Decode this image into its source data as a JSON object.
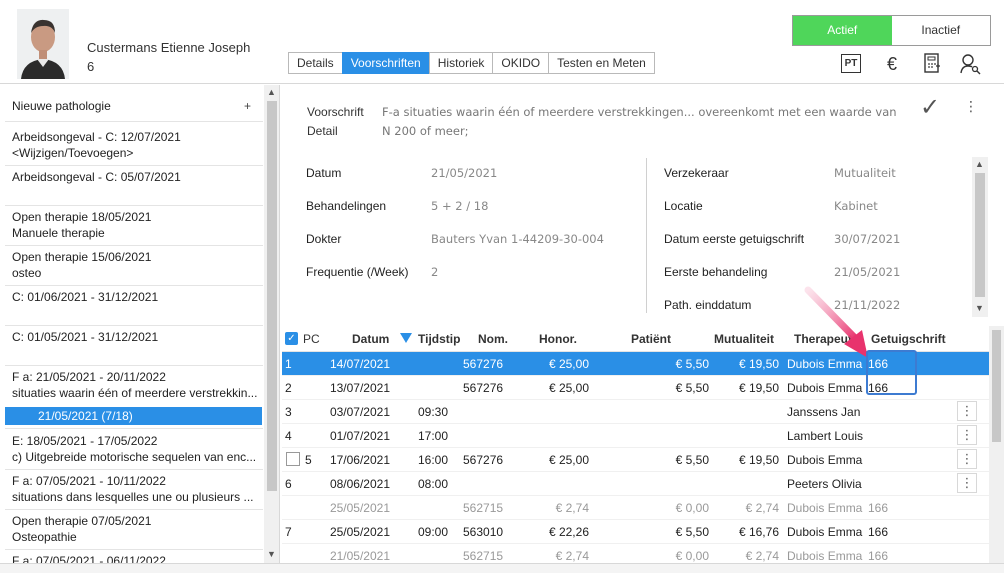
{
  "header": {
    "patient_name": "Custermans Etienne Joseph",
    "patient_number": "6",
    "tabs": [
      {
        "label": "Details"
      },
      {
        "label": "Voorschriften"
      },
      {
        "label": "Historiek"
      },
      {
        "label": "OKIDO"
      },
      {
        "label": "Testen en Meten"
      }
    ],
    "active_tab": "Voorschriften",
    "status_toggle": {
      "on": "Actief",
      "off": "Inactief"
    },
    "icons": [
      "pt-icon",
      "euro-icon",
      "calculator-icon",
      "user-search-icon"
    ],
    "pt_text": "PT",
    "euro_text": "€",
    "calc_text": "▦",
    "user_text": "⚲"
  },
  "sidebar": {
    "new_label": "Nieuwe pathologie",
    "plus": "+",
    "items": [
      {
        "line1": "Arbeidsongeval - C: 12/07/2021",
        "line2": "<Wijzigen/Toevoegen>"
      },
      {
        "line1": "Arbeidsongeval - C: 05/07/2021",
        "line2": ""
      },
      {
        "line1": "Open therapie 18/05/2021",
        "line2": "Manuele therapie"
      },
      {
        "line1": "Open therapie 15/06/2021",
        "line2": "osteo"
      },
      {
        "line1": "C: 01/06/2021 - 31/12/2021",
        "line2": ""
      },
      {
        "line1": "C: 01/05/2021 - 31/12/2021",
        "line2": ""
      },
      {
        "line1": "F a: 21/05/2021 - 20/11/2022",
        "line2": "situaties waarin één of meerdere verstrekkin..."
      },
      {
        "line1": "E: 18/05/2021 - 17/05/2022",
        "line2": "c) Uitgebreide motorische sequelen van enc..."
      },
      {
        "line1": "F a: 07/05/2021 - 10/11/2022",
        "line2": "situations dans lesquelles une ou plusieurs ..."
      },
      {
        "line1": "Open therapie 07/05/2021",
        "line2": "Osteopathie"
      },
      {
        "line1": "F a: 07/05/2021 - 06/11/2022",
        "line2": ""
      }
    ],
    "selected": "21/05/2021  (7/18)"
  },
  "detail": {
    "voorschrift_label": "Voorschrift",
    "detail_label": "Detail",
    "text_line1": "F-a situaties waarin één of meerdere verstrekkingen... overeenkomt met een waarde van",
    "text_line2": "N 200 of meer;",
    "left_fields": [
      {
        "label": "Datum",
        "value": "21/05/2021"
      },
      {
        "label": "Behandelingen",
        "value": "5 + 2 / 18"
      },
      {
        "label": "Dokter",
        "value": "Bauters Yvan 1-44209-30-004"
      },
      {
        "label": "Frequentie (/Week)",
        "value": "2"
      }
    ],
    "right_fields": [
      {
        "label": "Verzekeraar",
        "value": "Mutualiteit"
      },
      {
        "label": "Locatie",
        "value": "Kabinet"
      },
      {
        "label": "Datum eerste getuigschrift",
        "value": "30/07/2021"
      },
      {
        "label": "Eerste behandeling",
        "value": "21/05/2021"
      },
      {
        "label": "Path. einddatum",
        "value": "21/11/2022"
      }
    ],
    "check": "✓",
    "kebab": "⋮"
  },
  "grid": {
    "columns": {
      "pc": "PC",
      "datum": "Datum",
      "tijdstip": "Tijdstip",
      "nom": "Nom.",
      "honor": "Honor.",
      "patient": "Patiënt",
      "mutualiteit": "Mutualiteit",
      "therapeut": "Therapeut",
      "getuigschrift": "Getuigschrift"
    },
    "rows": [
      {
        "pc": "1",
        "datum": "14/07/2021",
        "tijd": "",
        "nom": "567276",
        "honor": "€ 25,00",
        "patient": "€ 5,50",
        "mut": "€ 19,50",
        "ther": "Dubois Emma",
        "getuig": "166",
        "kebab": "",
        "style": "sel"
      },
      {
        "pc": "2",
        "datum": "13/07/2021",
        "tijd": "",
        "nom": "567276",
        "honor": "€ 25,00",
        "patient": "€ 5,50",
        "mut": "€ 19,50",
        "ther": "Dubois Emma",
        "getuig": "166",
        "kebab": "",
        "style": ""
      },
      {
        "pc": "3",
        "datum": "03/07/2021",
        "tijd": "09:30",
        "nom": "",
        "honor": "",
        "patient": "",
        "mut": "",
        "ther": "Janssens Jan",
        "getuig": "",
        "kebab": "⋮",
        "style": ""
      },
      {
        "pc": "4",
        "datum": "01/07/2021",
        "tijd": "17:00",
        "nom": "",
        "honor": "",
        "patient": "",
        "mut": "",
        "ther": "Lambert Louis",
        "getuig": "",
        "kebab": "⋮",
        "style": ""
      },
      {
        "pc": "5",
        "datum": "17/06/2021",
        "tijd": "16:00",
        "nom": "567276",
        "honor": "€ 25,00",
        "patient": "€ 5,50",
        "mut": "€ 19,50",
        "ther": "Dubois Emma",
        "getuig": "",
        "kebab": "⋮",
        "style": "cbx"
      },
      {
        "pc": "6",
        "datum": "08/06/2021",
        "tijd": "08:00",
        "nom": "",
        "honor": "",
        "patient": "",
        "mut": "",
        "ther": "Peeters Olivia",
        "getuig": "",
        "kebab": "⋮",
        "style": ""
      },
      {
        "pc": "",
        "datum": "25/05/2021",
        "tijd": "",
        "nom": "562715",
        "honor": "€ 2,74",
        "patient": "€ 0,00",
        "mut": "€ 2,74",
        "ther": "Dubois Emma",
        "getuig": "166",
        "kebab": "",
        "style": "gray"
      },
      {
        "pc": "7",
        "datum": "25/05/2021",
        "tijd": "09:00",
        "nom": "563010",
        "honor": "€ 22,26",
        "patient": "€ 5,50",
        "mut": "€ 16,76",
        "ther": "Dubois Emma",
        "getuig": "166",
        "kebab": "",
        "style": ""
      },
      {
        "pc": "",
        "datum": "21/05/2021",
        "tijd": "",
        "nom": "562715",
        "honor": "€ 2,74",
        "patient": "€ 0,00",
        "mut": "€ 2,74",
        "ther": "Dubois Emma",
        "getuig": "166",
        "kebab": "",
        "style": "gray"
      }
    ]
  },
  "colors": {
    "accent": "#2a8fe6",
    "active_green": "#4fd65a",
    "annotation_pink": "#e8336d",
    "highlight_blue": "#3d7bd1"
  }
}
